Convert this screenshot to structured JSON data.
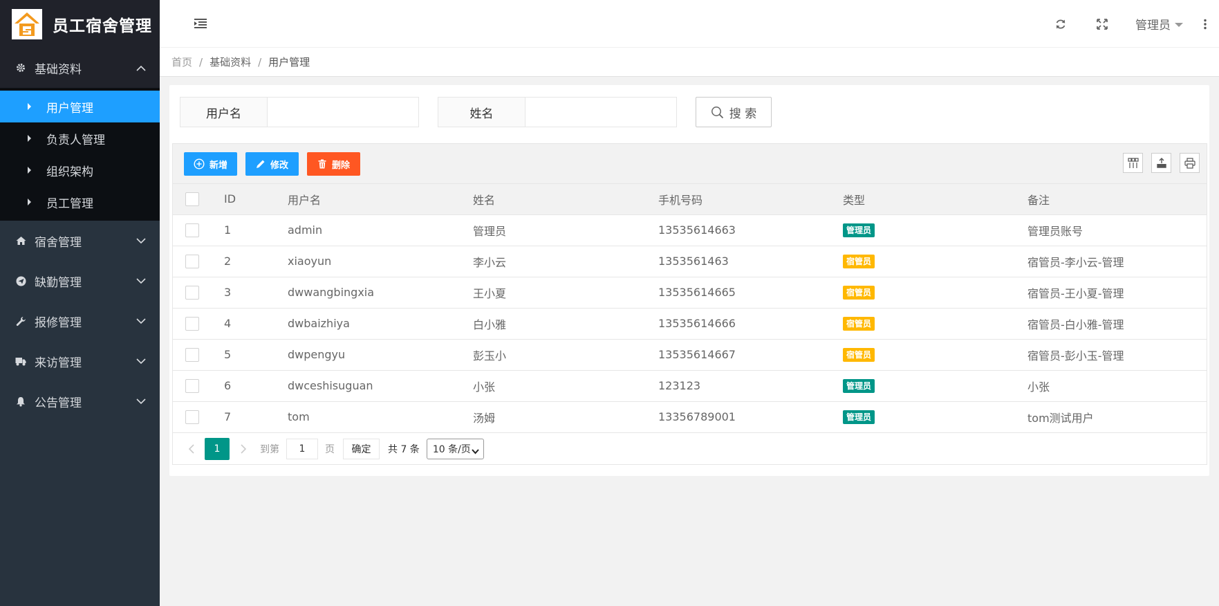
{
  "app": {
    "title": "员工宿舍管理"
  },
  "sidebar": {
    "groups": [
      {
        "label": "基础资料",
        "icon": "gear-icon",
        "open": true,
        "items": [
          {
            "label": "用户管理",
            "active": true
          },
          {
            "label": "负责人管理",
            "active": false
          },
          {
            "label": "组织架构",
            "active": false
          },
          {
            "label": "员工管理",
            "active": false
          }
        ]
      },
      {
        "label": "宿舍管理",
        "icon": "home-icon",
        "open": false
      },
      {
        "label": "缺勤管理",
        "icon": "paper-plane-icon",
        "open": false
      },
      {
        "label": "报修管理",
        "icon": "wrench-icon",
        "open": false
      },
      {
        "label": "来访管理",
        "icon": "truck-icon",
        "open": false
      },
      {
        "label": "公告管理",
        "icon": "bell-icon",
        "open": false
      }
    ]
  },
  "header": {
    "user": "管理员"
  },
  "breadcrumb": {
    "home": "首页",
    "section": "基础资料",
    "current": "用户管理"
  },
  "search": {
    "username_label": "用户名",
    "username_value": "",
    "name_label": "姓名",
    "name_value": "",
    "button": "搜 索"
  },
  "toolbar": {
    "add": "新增",
    "edit": "修改",
    "delete": "删除"
  },
  "table": {
    "columns": [
      "ID",
      "用户名",
      "姓名",
      "手机号码",
      "类型",
      "备注"
    ],
    "rows": [
      {
        "id": "1",
        "username": "admin",
        "name": "管理员",
        "phone": "13535614663",
        "type": "管理员",
        "type_kind": "admin",
        "note": "管理员账号"
      },
      {
        "id": "2",
        "username": "xiaoyun",
        "name": "李小云",
        "phone": "1353561463",
        "type": "宿管员",
        "type_kind": "manager",
        "note": "宿管员-李小云-管理"
      },
      {
        "id": "3",
        "username": "dwwangbingxia",
        "name": "王小夏",
        "phone": "13535614665",
        "type": "宿管员",
        "type_kind": "manager",
        "note": "宿管员-王小夏-管理"
      },
      {
        "id": "4",
        "username": "dwbaizhiya",
        "name": "白小雅",
        "phone": "13535614666",
        "type": "宿管员",
        "type_kind": "manager",
        "note": "宿管员-白小雅-管理"
      },
      {
        "id": "5",
        "username": "dwpengyu",
        "name": "彭玉小",
        "phone": "13535614667",
        "type": "宿管员",
        "type_kind": "manager",
        "note": "宿管员-彭小玉-管理"
      },
      {
        "id": "6",
        "username": "dwceshisuguan",
        "name": "小张",
        "phone": "123123",
        "type": "管理员",
        "type_kind": "admin",
        "note": "小张"
      },
      {
        "id": "7",
        "username": "tom",
        "name": "汤姆",
        "phone": "13356789001",
        "type": "管理员",
        "type_kind": "admin",
        "note": "tom测试用户"
      }
    ]
  },
  "pager": {
    "current": "1",
    "goto_label": "到第",
    "goto_value": "1",
    "page_label": "页",
    "confirm": "确定",
    "total": "共 7 条",
    "page_size": "10 条/页"
  },
  "colors": {
    "primary": "#1e9fff",
    "danger": "#ff5722",
    "admin_badge": "#009688",
    "manager_badge": "#ffb800",
    "sidebar": "#28333e"
  }
}
